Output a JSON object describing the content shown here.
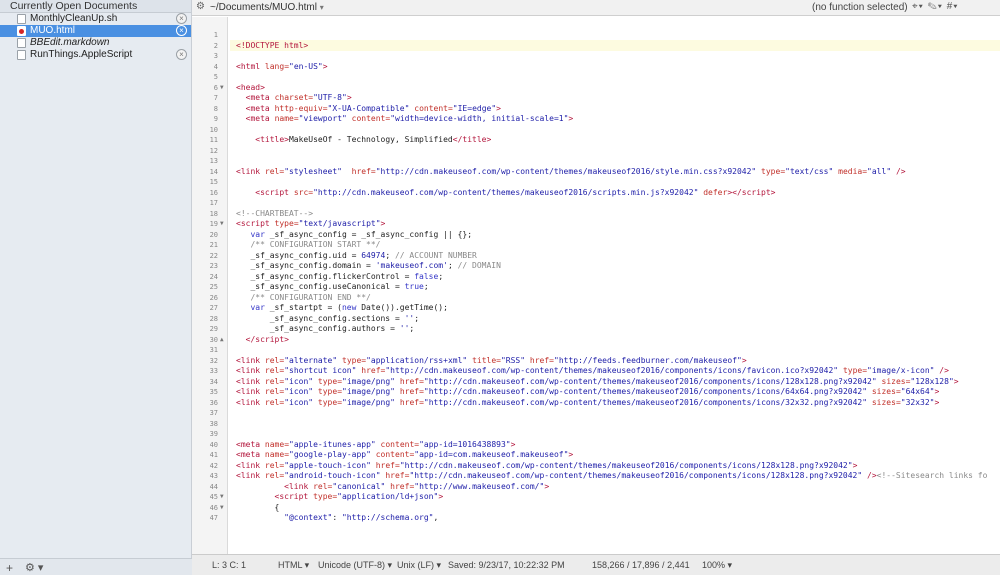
{
  "sidebar": {
    "header": "Currently Open Documents",
    "items": [
      {
        "label": "MonthlyCleanUp.sh",
        "selected": false
      },
      {
        "label": "MUO.html",
        "selected": true
      },
      {
        "label": "BBEdit.markdown",
        "selected": false
      },
      {
        "label": "RunThings.AppleScript",
        "selected": false
      }
    ],
    "footer": {
      "add": "+",
      "action": "⚙ ▾"
    }
  },
  "navbar": {
    "path": "~/Documents/MUO.html",
    "function_menu": "(no function selected)",
    "tools": "⌖▾  ✎▾  #▾"
  },
  "editor": {
    "current_line": 3,
    "lines": [
      {
        "n": "1",
        "fold": "",
        "code": ""
      },
      {
        "n": "2",
        "fold": "",
        "code": "<span class='tag'>&lt;!DOCTYPE html&gt;</span>"
      },
      {
        "n": "3",
        "fold": "",
        "code": ""
      },
      {
        "n": "4",
        "fold": "",
        "code": "<span class='tag'>&lt;html</span> <span class='attr'>lang=</span><span class='str'>\"en-US\"</span><span class='tag'>&gt;</span>"
      },
      {
        "n": "5",
        "fold": "",
        "code": ""
      },
      {
        "n": "6",
        "fold": "▼",
        "code": "<span class='tag'>&lt;head&gt;</span>"
      },
      {
        "n": "7",
        "fold": "",
        "code": "  <span class='tag'>&lt;meta</span> <span class='attr'>charset=</span><span class='str'>\"UTF-8\"</span><span class='tag'>&gt;</span>"
      },
      {
        "n": "8",
        "fold": "",
        "code": "  <span class='tag'>&lt;meta</span> <span class='attr'>http-equiv=</span><span class='str'>\"X-UA-Compatible\"</span> <span class='attr'>content=</span><span class='str'>\"IE=edge\"</span><span class='tag'>&gt;</span>"
      },
      {
        "n": "9",
        "fold": "",
        "code": "  <span class='tag'>&lt;meta</span> <span class='attr'>name=</span><span class='str'>\"viewport\"</span> <span class='attr'>content=</span><span class='str'>\"width=device-width, initial-scale=1\"</span><span class='tag'>&gt;</span>"
      },
      {
        "n": "10",
        "fold": "",
        "code": ""
      },
      {
        "n": "11",
        "fold": "",
        "code": "    <span class='tag'>&lt;title&gt;</span><span class='txt'>MakeUseOf - Technology, Simplified</span><span class='tag'>&lt;/title&gt;</span>"
      },
      {
        "n": "12",
        "fold": "",
        "code": ""
      },
      {
        "n": "13",
        "fold": "",
        "code": ""
      },
      {
        "n": "14",
        "fold": "",
        "code": "<span class='tag'>&lt;link</span> <span class='attr'>rel=</span><span class='str'>\"stylesheet\"</span>  <span class='attr'>href=</span><span class='str'>\"http://cdn.makeuseof.com/wp-content/themes/makeuseof2016/style.min.css?x92042\"</span> <span class='attr'>type=</span><span class='str'>\"text/css\"</span> <span class='attr'>media=</span><span class='str'>\"all\"</span> <span class='tag'>/&gt;</span>"
      },
      {
        "n": "15",
        "fold": "",
        "code": ""
      },
      {
        "n": "16",
        "fold": "",
        "code": "    <span class='tag'>&lt;script</span> <span class='attr'>src=</span><span class='str'>\"http://cdn.makeuseof.com/wp-content/themes/makeuseof2016/scripts.min.js?x92042\"</span> <span class='attr'>defer</span><span class='tag'>&gt;&lt;/script&gt;</span>"
      },
      {
        "n": "17",
        "fold": "",
        "code": ""
      },
      {
        "n": "18",
        "fold": "",
        "code": "<span class='cmt'>&lt;!--CHARTBEAT--&gt;</span>"
      },
      {
        "n": "19",
        "fold": "▼",
        "code": "<span class='tag'>&lt;script</span> <span class='attr'>type=</span><span class='str'>\"text/javascript\"</span><span class='tag'>&gt;</span>"
      },
      {
        "n": "20",
        "fold": "",
        "code": "   <span class='kw'>var</span> _sf_async_config = _sf_async_config || {};"
      },
      {
        "n": "21",
        "fold": "",
        "code": "   <span class='cmt'>/** CONFIGURATION START **/</span>"
      },
      {
        "n": "22",
        "fold": "",
        "code": "   _sf_async_config.uid = <span class='str'>64974</span>; <span class='cmt'>// ACCOUNT NUMBER</span>"
      },
      {
        "n": "23",
        "fold": "",
        "code": "   _sf_async_config.domain = <span class='str'>'makeuseof.com'</span>; <span class='cmt'>// DOMAIN</span>"
      },
      {
        "n": "24",
        "fold": "",
        "code": "   _sf_async_config.flickerControl = <span class='kw'>false</span>;"
      },
      {
        "n": "25",
        "fold": "",
        "code": "   _sf_async_config.useCanonical = <span class='kw'>true</span>;"
      },
      {
        "n": "26",
        "fold": "",
        "code": "   <span class='cmt'>/** CONFIGURATION END **/</span>"
      },
      {
        "n": "27",
        "fold": "",
        "code": "   <span class='kw'>var</span> _sf_startpt = (<span class='kw'>new</span> Date()).getTime();"
      },
      {
        "n": "28",
        "fold": "",
        "code": "       _sf_async_config.sections = <span class='str'>''</span>;"
      },
      {
        "n": "29",
        "fold": "",
        "code": "       _sf_async_config.authors = <span class='str'>''</span>;"
      },
      {
        "n": "30",
        "fold": "▲",
        "code": "  <span class='tag'>&lt;/script&gt;</span>"
      },
      {
        "n": "31",
        "fold": "",
        "code": ""
      },
      {
        "n": "32",
        "fold": "",
        "code": "<span class='tag'>&lt;link</span> <span class='attr'>rel=</span><span class='str'>\"alternate\"</span> <span class='attr'>type=</span><span class='str'>\"application/rss+xml\"</span> <span class='attr'>title=</span><span class='str'>\"RSS\"</span> <span class='attr'>href=</span><span class='str'>\"http://feeds.feedburner.com/makeuseof\"</span><span class='tag'>&gt;</span>"
      },
      {
        "n": "33",
        "fold": "",
        "code": "<span class='tag'>&lt;link</span> <span class='attr'>rel=</span><span class='str'>\"shortcut icon\"</span> <span class='attr'>href=</span><span class='str'>\"http://cdn.makeuseof.com/wp-content/themes/makeuseof2016/components/icons/favicon.ico?x92042\"</span> <span class='attr'>type=</span><span class='str'>\"image/x-icon\"</span> <span class='tag'>/&gt;</span>"
      },
      {
        "n": "34",
        "fold": "",
        "code": "<span class='tag'>&lt;link</span> <span class='attr'>rel=</span><span class='str'>\"icon\"</span> <span class='attr'>type=</span><span class='str'>\"image/png\"</span> <span class='attr'>href=</span><span class='str'>\"http://cdn.makeuseof.com/wp-content/themes/makeuseof2016/components/icons/128x128.png?x92042\"</span> <span class='attr'>sizes=</span><span class='str'>\"128x128\"</span><span class='tag'>&gt;</span>"
      },
      {
        "n": "35",
        "fold": "",
        "code": "<span class='tag'>&lt;link</span> <span class='attr'>rel=</span><span class='str'>\"icon\"</span> <span class='attr'>type=</span><span class='str'>\"image/png\"</span> <span class='attr'>href=</span><span class='str'>\"http://cdn.makeuseof.com/wp-content/themes/makeuseof2016/components/icons/64x64.png?x92042\"</span> <span class='attr'>sizes=</span><span class='str'>\"64x64\"</span><span class='tag'>&gt;</span>"
      },
      {
        "n": "36",
        "fold": "",
        "code": "<span class='tag'>&lt;link</span> <span class='attr'>rel=</span><span class='str'>\"icon\"</span> <span class='attr'>type=</span><span class='str'>\"image/png\"</span> <span class='attr'>href=</span><span class='str'>\"http://cdn.makeuseof.com/wp-content/themes/makeuseof2016/components/icons/32x32.png?x92042\"</span> <span class='attr'>sizes=</span><span class='str'>\"32x32\"</span><span class='tag'>&gt;</span>"
      },
      {
        "n": "37",
        "fold": "",
        "code": ""
      },
      {
        "n": "38",
        "fold": "",
        "code": ""
      },
      {
        "n": "39",
        "fold": "",
        "code": ""
      },
      {
        "n": "40",
        "fold": "",
        "code": "<span class='tag'>&lt;meta</span> <span class='attr'>name=</span><span class='str'>\"apple-itunes-app\"</span> <span class='attr'>content=</span><span class='str'>\"app-id=1016438893\"</span><span class='tag'>&gt;</span>"
      },
      {
        "n": "41",
        "fold": "",
        "code": "<span class='tag'>&lt;meta</span> <span class='attr'>name=</span><span class='str'>\"google-play-app\"</span> <span class='attr'>content=</span><span class='str'>\"app-id=com.makeuseof.makeuseof\"</span><span class='tag'>&gt;</span>"
      },
      {
        "n": "42",
        "fold": "",
        "code": "<span class='tag'>&lt;link</span> <span class='attr'>rel=</span><span class='str'>\"apple-touch-icon\"</span> <span class='attr'>href=</span><span class='str'>\"http://cdn.makeuseof.com/wp-content/themes/makeuseof2016/components/icons/128x128.png?x92042\"</span><span class='tag'>&gt;</span>"
      },
      {
        "n": "43",
        "fold": "",
        "code": "<span class='tag'>&lt;link</span> <span class='attr'>rel=</span><span class='str'>\"android-touch-icon\"</span> <span class='attr'>href=</span><span class='str'>\"http://cdn.makeuseof.com/wp-content/themes/makeuseof2016/components/icons/128x128.png?x92042\"</span> <span class='tag'>/&gt;</span><span class='cmt'>&lt;!--Sitesearch links fo</span>"
      },
      {
        "n": "44",
        "fold": "",
        "code": "          <span class='tag'>&lt;link</span> <span class='attr'>rel=</span><span class='str'>\"canonical\"</span> <span class='attr'>href=</span><span class='str'>\"http://www.makeuseof.com/\"</span><span class='tag'>&gt;</span>"
      },
      {
        "n": "45",
        "fold": "▼",
        "code": "        <span class='tag'>&lt;script</span> <span class='attr'>type=</span><span class='str'>\"application/ld+json\"</span><span class='tag'>&gt;</span>"
      },
      {
        "n": "46",
        "fold": "▼",
        "code": "        {"
      },
      {
        "n": "47",
        "fold": "",
        "code": "          <span class='str'>\"@context\"</span>: <span class='str'>\"http://schema.org\"</span>,"
      }
    ]
  },
  "statusbar": {
    "position": "L: 3 C: 1",
    "language": "HTML ▾",
    "encoding": "Unicode (UTF-8) ▾",
    "line_endings": "Unix (LF) ▾",
    "saved": "Saved: 9/23/17, 10:22:32 PM",
    "counts": "158,266 / 17,896 / 2,441",
    "zoom": "100% ▾"
  }
}
